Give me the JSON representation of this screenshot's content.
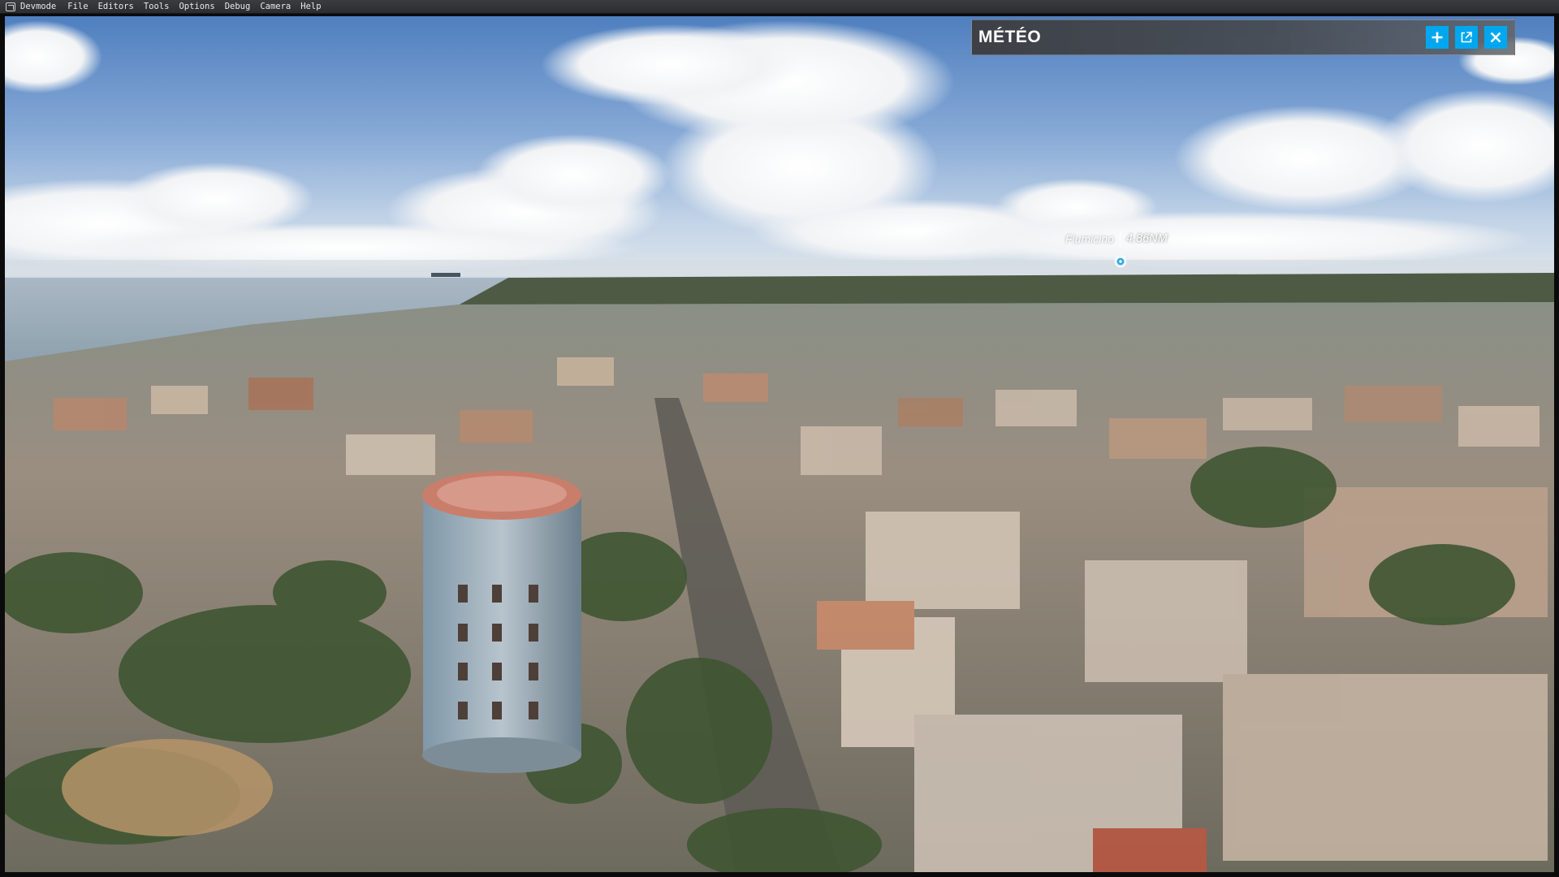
{
  "menubar": {
    "brand": "Devmode",
    "items": [
      "File",
      "Editors",
      "Tools",
      "Options",
      "Debug",
      "Camera",
      "Help"
    ]
  },
  "weather_window": {
    "title": "MÉTÉO",
    "buttons": [
      {
        "name": "add-icon"
      },
      {
        "name": "popout-icon"
      },
      {
        "name": "close-icon"
      }
    ],
    "accent_color": "#00a7ef"
  },
  "poi": {
    "name": "Fiumicino",
    "distance": "4.86NM",
    "icon": "map-pin-icon"
  }
}
